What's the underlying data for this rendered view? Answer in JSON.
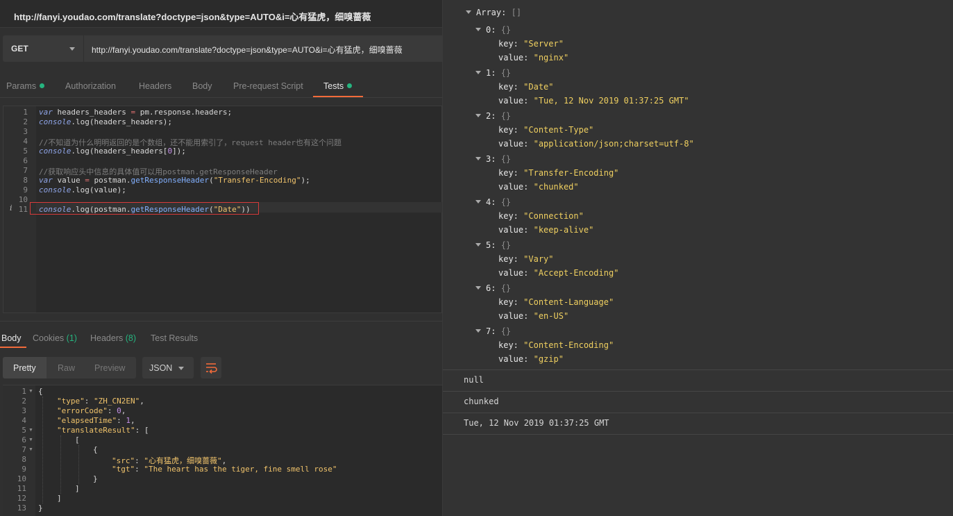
{
  "window": {
    "title": "http://fanyi.youdao.com/translate?doctype=json&type=AUTO&i=心有猛虎，细嗅蔷薇"
  },
  "request": {
    "method": "GET",
    "url": "http://fanyi.youdao.com/translate?doctype=json&type=AUTO&i=心有猛虎，细嗅蔷薇",
    "tabs": [
      "Params",
      "Authorization",
      "Headers",
      "Body",
      "Pre-request Script",
      "Tests"
    ]
  },
  "editor": {
    "line_numbers": [
      "1",
      "2",
      "3",
      "4",
      "5",
      "6",
      "7",
      "8",
      "9",
      "10",
      "11"
    ],
    "line1": [
      "var",
      " headers_headers ",
      "=",
      " pm.response.headers;"
    ],
    "line2": [
      "console",
      ".log(headers_headers);"
    ],
    "line4": "//不知道为什么明明返回的是个数组，还不能用索引了，request header也有这个问题",
    "line5": [
      "console",
      ".log(headers_headers[",
      "0",
      "]);"
    ],
    "line7": "//获取响应头中信息的具体值可以用postman.getResponseHeader",
    "line8": [
      "var",
      " value ",
      "=",
      " postman.",
      "getResponseHeader",
      "(",
      "\"Transfer-Encoding\"",
      ");"
    ],
    "line9": [
      "console",
      ".log(value);"
    ],
    "line11": [
      "console",
      ".log(postman.",
      "getResponseHeader",
      "(",
      "\"Date\"",
      "))"
    ],
    "info_marker": "i"
  },
  "response": {
    "tabs": {
      "body": "Body",
      "cookies": "Cookies",
      "cookies_count": "(1)",
      "headers": "Headers",
      "headers_count": "(8)",
      "test_results": "Test Results"
    },
    "view_modes": [
      "Pretty",
      "Raw",
      "Preview"
    ],
    "format": "JSON",
    "line_numbers": [
      "1",
      "2",
      "3",
      "4",
      "5",
      "6",
      "7",
      "8",
      "9",
      "10",
      "11",
      "12",
      "13"
    ],
    "json": {
      "open": "{",
      "type_key": "\"type\"",
      "type_val": "\"ZH_CN2EN\"",
      "errorCode_key": "\"errorCode\"",
      "errorCode_val": "0",
      "elapsedTime_key": "\"elapsedTime\"",
      "elapsedTime_val": "1",
      "translateResult_key": "\"translateResult\"",
      "arr_open": "[",
      "arr2_open": "[",
      "obj_open": "{",
      "src_key": "\"src\"",
      "src_val": "\"心有猛虎，细嗅蔷薇\"",
      "tgt_key": "\"tgt\"",
      "tgt_val": "\"The heart has the tiger, fine smell rose\"",
      "obj_close": "}",
      "arr2_close": "]",
      "arr_close": "]",
      "close": "}"
    }
  },
  "console": {
    "array_label": "Array:",
    "empty_array": "[]",
    "empty_obj": "{}",
    "key_label": "key:",
    "value_label": "value:",
    "items": [
      {
        "index": "0:",
        "key": "\"Server\"",
        "value": "\"nginx\""
      },
      {
        "index": "1:",
        "key": "\"Date\"",
        "value": "\"Tue, 12 Nov 2019 01:37:25 GMT\""
      },
      {
        "index": "2:",
        "key": "\"Content-Type\"",
        "value": "\"application/json;charset=utf-8\""
      },
      {
        "index": "3:",
        "key": "\"Transfer-Encoding\"",
        "value": "\"chunked\""
      },
      {
        "index": "4:",
        "key": "\"Connection\"",
        "value": "\"keep-alive\""
      },
      {
        "index": "5:",
        "key": "\"Vary\"",
        "value": "\"Accept-Encoding\""
      },
      {
        "index": "6:",
        "key": "\"Content-Language\"",
        "value": "\"en-US\""
      },
      {
        "index": "7:",
        "key": "\"Content-Encoding\"",
        "value": "\"gzip\""
      }
    ],
    "logs": [
      "null",
      "chunked",
      "Tue, 12 Nov 2019 01:37:25 GMT"
    ]
  },
  "colors": {
    "accent": "#f26b3a",
    "status_dot": "#26b47f",
    "highlight_box": "#d83a3a"
  }
}
